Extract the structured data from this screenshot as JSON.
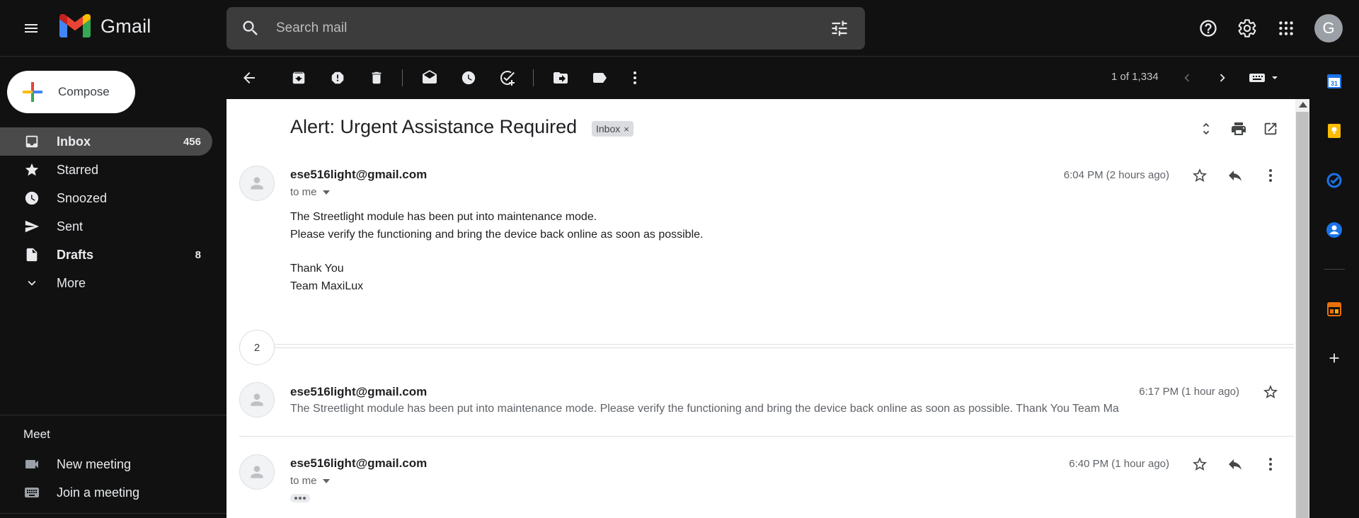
{
  "app": {
    "name": "Gmail"
  },
  "search": {
    "placeholder": "Search mail"
  },
  "account": {
    "initial": "G"
  },
  "compose": {
    "label": "Compose"
  },
  "nav": {
    "items": [
      {
        "label": "Inbox",
        "count": "456",
        "active": true,
        "bold": true,
        "icon": "inbox-icon"
      },
      {
        "label": "Starred",
        "count": "",
        "icon": "star-icon"
      },
      {
        "label": "Snoozed",
        "count": "",
        "icon": "clock-icon"
      },
      {
        "label": "Sent",
        "count": "",
        "icon": "send-icon"
      },
      {
        "label": "Drafts",
        "count": "8",
        "bold": true,
        "icon": "draft-icon"
      },
      {
        "label": "More",
        "count": "",
        "icon": "chevron-down-icon"
      }
    ]
  },
  "meet": {
    "title": "Meet",
    "items": [
      {
        "label": "New meeting",
        "icon": "video-icon"
      },
      {
        "label": "Join a meeting",
        "icon": "keyboard-icon"
      }
    ]
  },
  "toolbar": {
    "pager": "1 of 1,334"
  },
  "thread": {
    "subject": "Alert: Urgent Assistance Required",
    "label_chip": "Inbox",
    "label_chip_close": "×",
    "collapsed_count": "2",
    "messages": [
      {
        "sender": "ese516light@gmail.com",
        "to": "to me",
        "time": "6:04 PM (2 hours ago)",
        "body": [
          "The Streetlight module has been put into maintenance mode.",
          "Please verify the functioning and bring the device back online as soon as possible.",
          "Thank You",
          "Team MaxiLux"
        ]
      },
      {
        "sender": "ese516light@gmail.com",
        "time": "6:17 PM (1 hour ago)",
        "snippet": "The Streetlight module has been put into maintenance mode. Please verify the functioning and bring the device back online as soon as possible. Thank You Team Ma"
      },
      {
        "sender": "ese516light@gmail.com",
        "to": "to me",
        "time": "6:40 PM (1 hour ago)"
      }
    ]
  },
  "colors": {
    "background": "#111111",
    "search_bg": "#3c3c3c",
    "active_nav": "#4a4a4a",
    "content_bg": "#ffffff"
  }
}
